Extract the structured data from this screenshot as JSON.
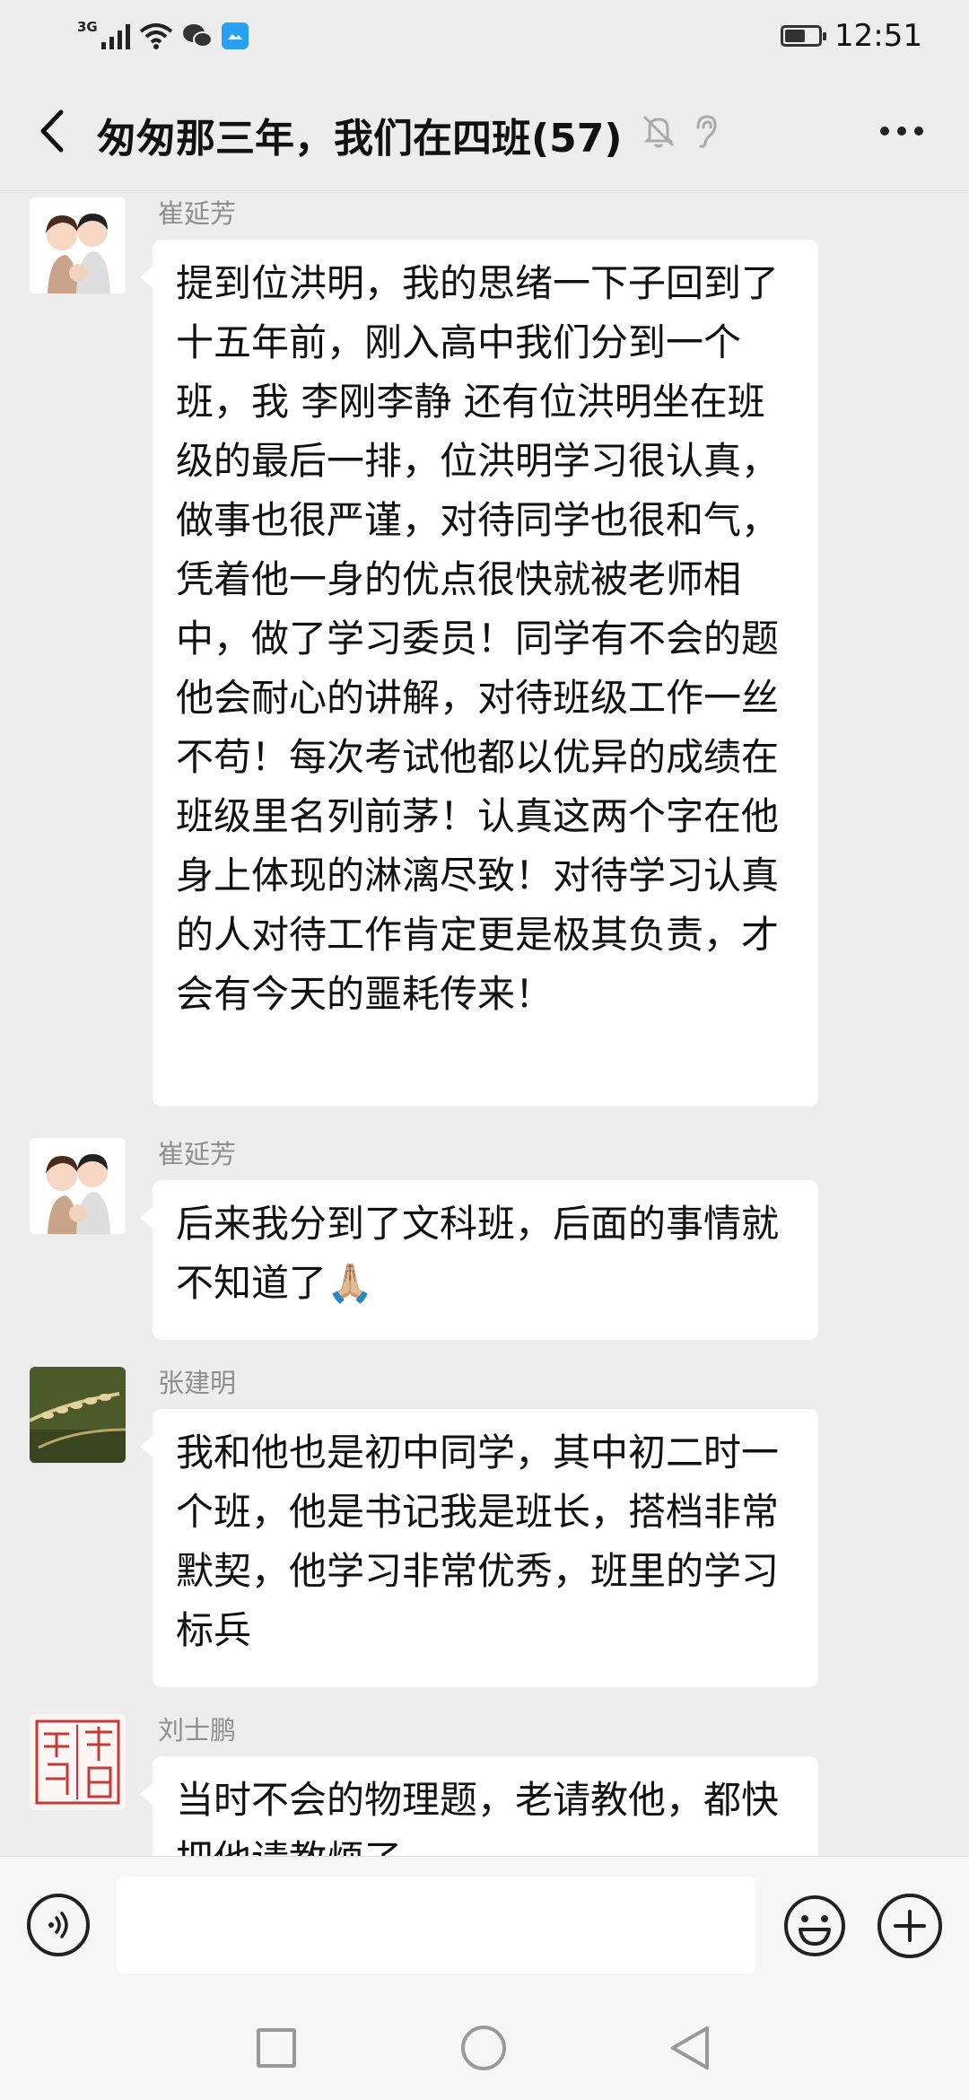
{
  "status_bar": {
    "network": "3G",
    "time": "12:51",
    "battery_level": 0.6
  },
  "header": {
    "title": "匆匆那三年，我们在四班(57)"
  },
  "messages": [
    {
      "sender": "崔延芳",
      "avatar": "couple-cartoon-avatar",
      "text": "提到位洪明，我的思绪一下子回到了十五年前，刚入高中我们分到一个班，我 李刚李静 还有位洪明坐在班级的最后一排，位洪明学习很认真，做事也很严谨，对待同学也很和气，凭着他一身的优点很快就被老师相中，做了学习委员！同学有不会的题他会耐心的讲解，对待班级工作一丝不苟！每次考试他都以优异的成绩在班级里名列前茅！认真这两个字在他身上体现的淋漓尽致！对待学习认真的人对待工作肯定更是极其负责，才会有今天的噩耗传来！"
    },
    {
      "sender": "崔延芳",
      "avatar": "couple-cartoon-avatar",
      "text": "后来我分到了文科班，后面的事情就不知道了🙏🏼"
    },
    {
      "sender": "张建明",
      "avatar": "wheat-avatar",
      "text": "我和他也是初中同学，其中初二时一个班，他是书记我是班长，搭档非常默契，他学习非常优秀，班里的学习标兵"
    },
    {
      "sender": "刘士鹏",
      "avatar": "seal-stamp-avatar",
      "text": "当时不会的物理题，老请教他，都快把他请教烦了。"
    }
  ],
  "input_bar": {
    "value": "",
    "placeholder": ""
  },
  "colors": {
    "background": "#ededed",
    "bubble": "#ffffff",
    "sender_name": "#8e8e8e"
  }
}
